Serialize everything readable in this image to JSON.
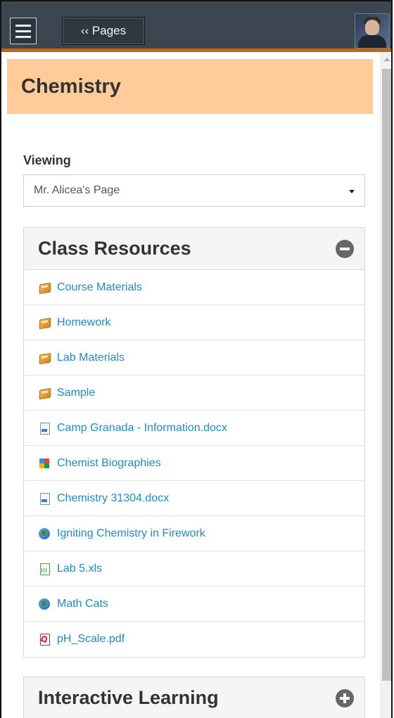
{
  "topbar": {
    "pages_button": "‹‹ Pages"
  },
  "page": {
    "title": "Chemistry"
  },
  "viewing": {
    "label": "Viewing",
    "selected": "Mr. Alicea's Page"
  },
  "class_resources": {
    "title": "Class Resources",
    "items": [
      {
        "label": "Course Materials",
        "icon": "folder-icon"
      },
      {
        "label": "Homework",
        "icon": "folder-icon"
      },
      {
        "label": "Lab Materials",
        "icon": "folder-icon"
      },
      {
        "label": "Sample",
        "icon": "folder-icon"
      },
      {
        "label": "Camp Granada - Information.docx",
        "icon": "document-icon"
      },
      {
        "label": "Chemist Biographies",
        "icon": "google-sites-icon"
      },
      {
        "label": "Chemistry 31304.docx",
        "icon": "document-icon"
      },
      {
        "label": "Igniting Chemistry in Firework",
        "icon": "globe-icon"
      },
      {
        "label": "Lab 5.xls",
        "icon": "spreadsheet-icon"
      },
      {
        "label": "Math Cats",
        "icon": "globe-icon"
      },
      {
        "label": "pH_Scale.pdf",
        "icon": "pdf-icon"
      }
    ]
  },
  "interactive_learning": {
    "title": "Interactive Learning"
  },
  "colors": {
    "topbar": "#3c4650",
    "accent_orange": "#c8630e",
    "title_band": "#ffcb99",
    "link": "#1c8dc0"
  }
}
